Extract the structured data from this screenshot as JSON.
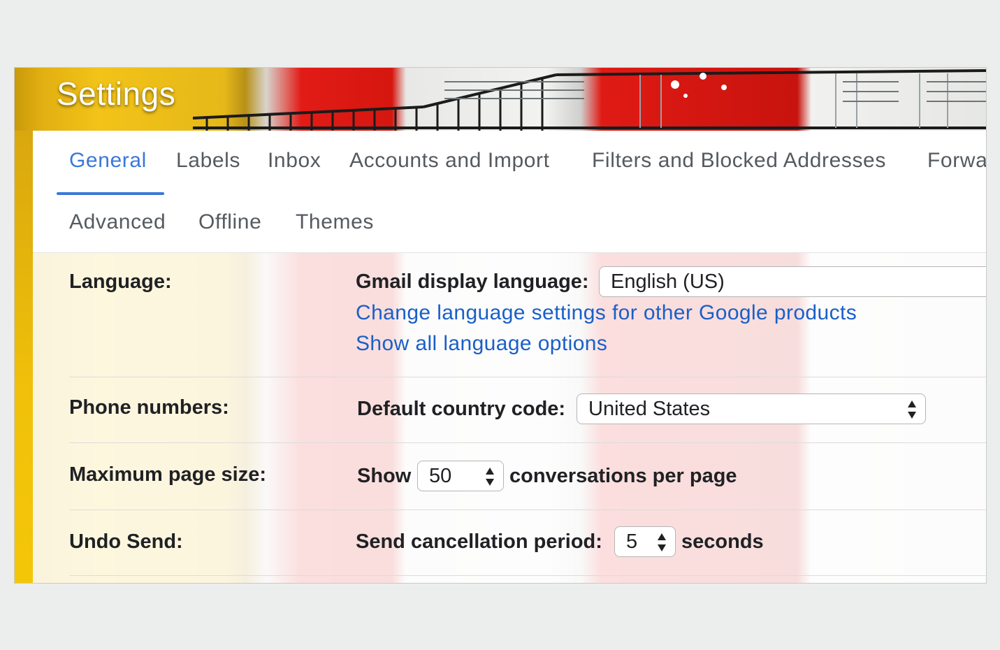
{
  "page": {
    "title": "Settings"
  },
  "tabs": [
    {
      "label": "General",
      "active": true
    },
    {
      "label": "Labels"
    },
    {
      "label": "Inbox"
    },
    {
      "label": "Accounts and Import"
    },
    {
      "label": "Filters and Blocked Addresses"
    },
    {
      "label": "Forwa"
    },
    {
      "label": "Advanced"
    },
    {
      "label": "Offline"
    },
    {
      "label": "Themes"
    }
  ],
  "settings": {
    "language": {
      "label": "Language:",
      "field_label": "Gmail display language:",
      "value": "English (US)",
      "link_change": "Change language settings for other Google products",
      "link_show_all": "Show all language options"
    },
    "phone": {
      "label": "Phone numbers:",
      "field_label": "Default country code:",
      "value": "United States"
    },
    "page_size": {
      "label": "Maximum page size:",
      "prefix": "Show",
      "value": "50",
      "suffix": "conversations per page"
    },
    "undo_send": {
      "label": "Undo Send:",
      "field_label": "Send cancellation period:",
      "value": "5",
      "suffix": "seconds"
    }
  },
  "colors": {
    "accent": "#3a78d8",
    "link": "#1a5fc8",
    "text": "#202124"
  },
  "icons": {
    "stepper": "up-down-arrows-icon"
  }
}
